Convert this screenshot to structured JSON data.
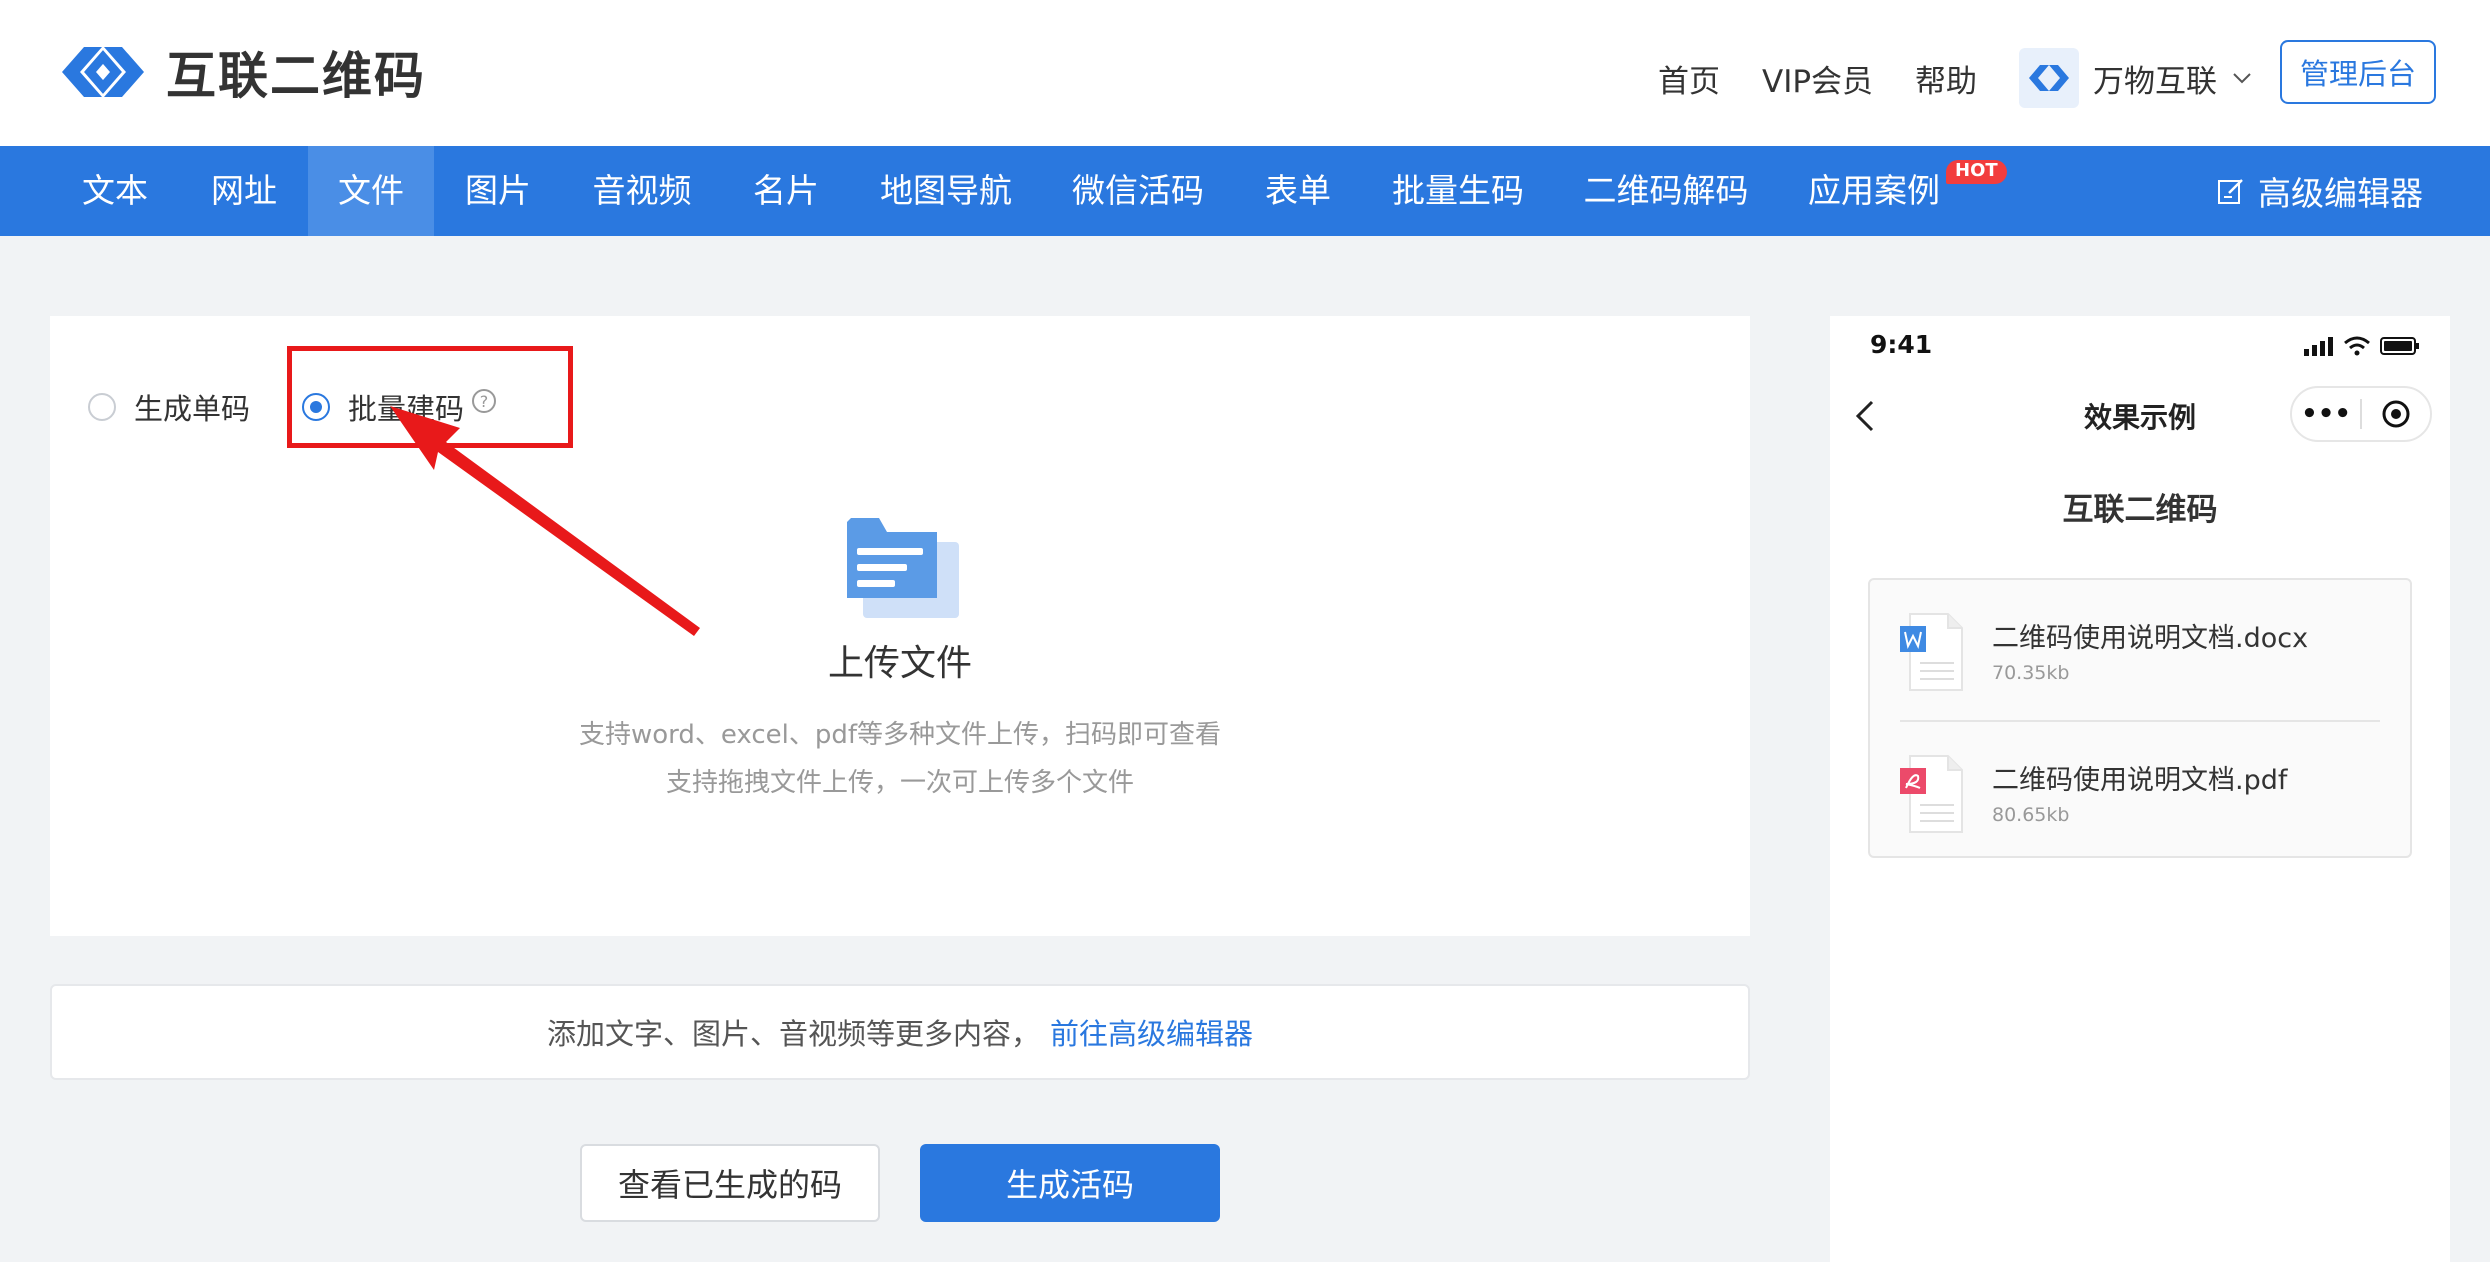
{
  "header": {
    "logo_text": "互联二维码",
    "links": [
      "首页",
      "VIP会员",
      "帮助"
    ],
    "org_name": "万物互联",
    "admin_label": "管理后台"
  },
  "nav": {
    "items": [
      "文本",
      "网址",
      "文件",
      "图片",
      "音视频",
      "名片",
      "地图导航",
      "微信活码",
      "表单",
      "批量生码",
      "二维码解码",
      "应用案例"
    ],
    "active": "文件",
    "hot_badge": "HOT",
    "advanced_editor": "高级编辑器"
  },
  "upload_card": {
    "radio_single": "生成单码",
    "radio_batch": "批量建码",
    "selected": "批量建码",
    "help_glyph": "?",
    "title": "上传文件",
    "desc_line1": "支持word、excel、pdf等多种文件上传，扫码即可查看",
    "desc_line2": "支持拖拽文件上传，一次可上传多个文件"
  },
  "more": {
    "text": "添加文字、图片、音视频等更多内容，",
    "link": "前往高级编辑器"
  },
  "buttons": {
    "view_generated": "查看已生成的码",
    "generate": "生成活码"
  },
  "preview": {
    "time": "9:41",
    "page_title": "效果示例",
    "more_glyph": "•••",
    "subtitle": "互联二维码",
    "files": [
      {
        "name": "二维码使用说明文档.docx",
        "size": "70.35kb",
        "type": "word-icon"
      },
      {
        "name": "二维码使用说明文档.pdf",
        "size": "80.65kb",
        "type": "pdf-icon"
      }
    ]
  },
  "colors": {
    "brand_blue": "#2a78df",
    "annotation_red": "#e8191a"
  }
}
